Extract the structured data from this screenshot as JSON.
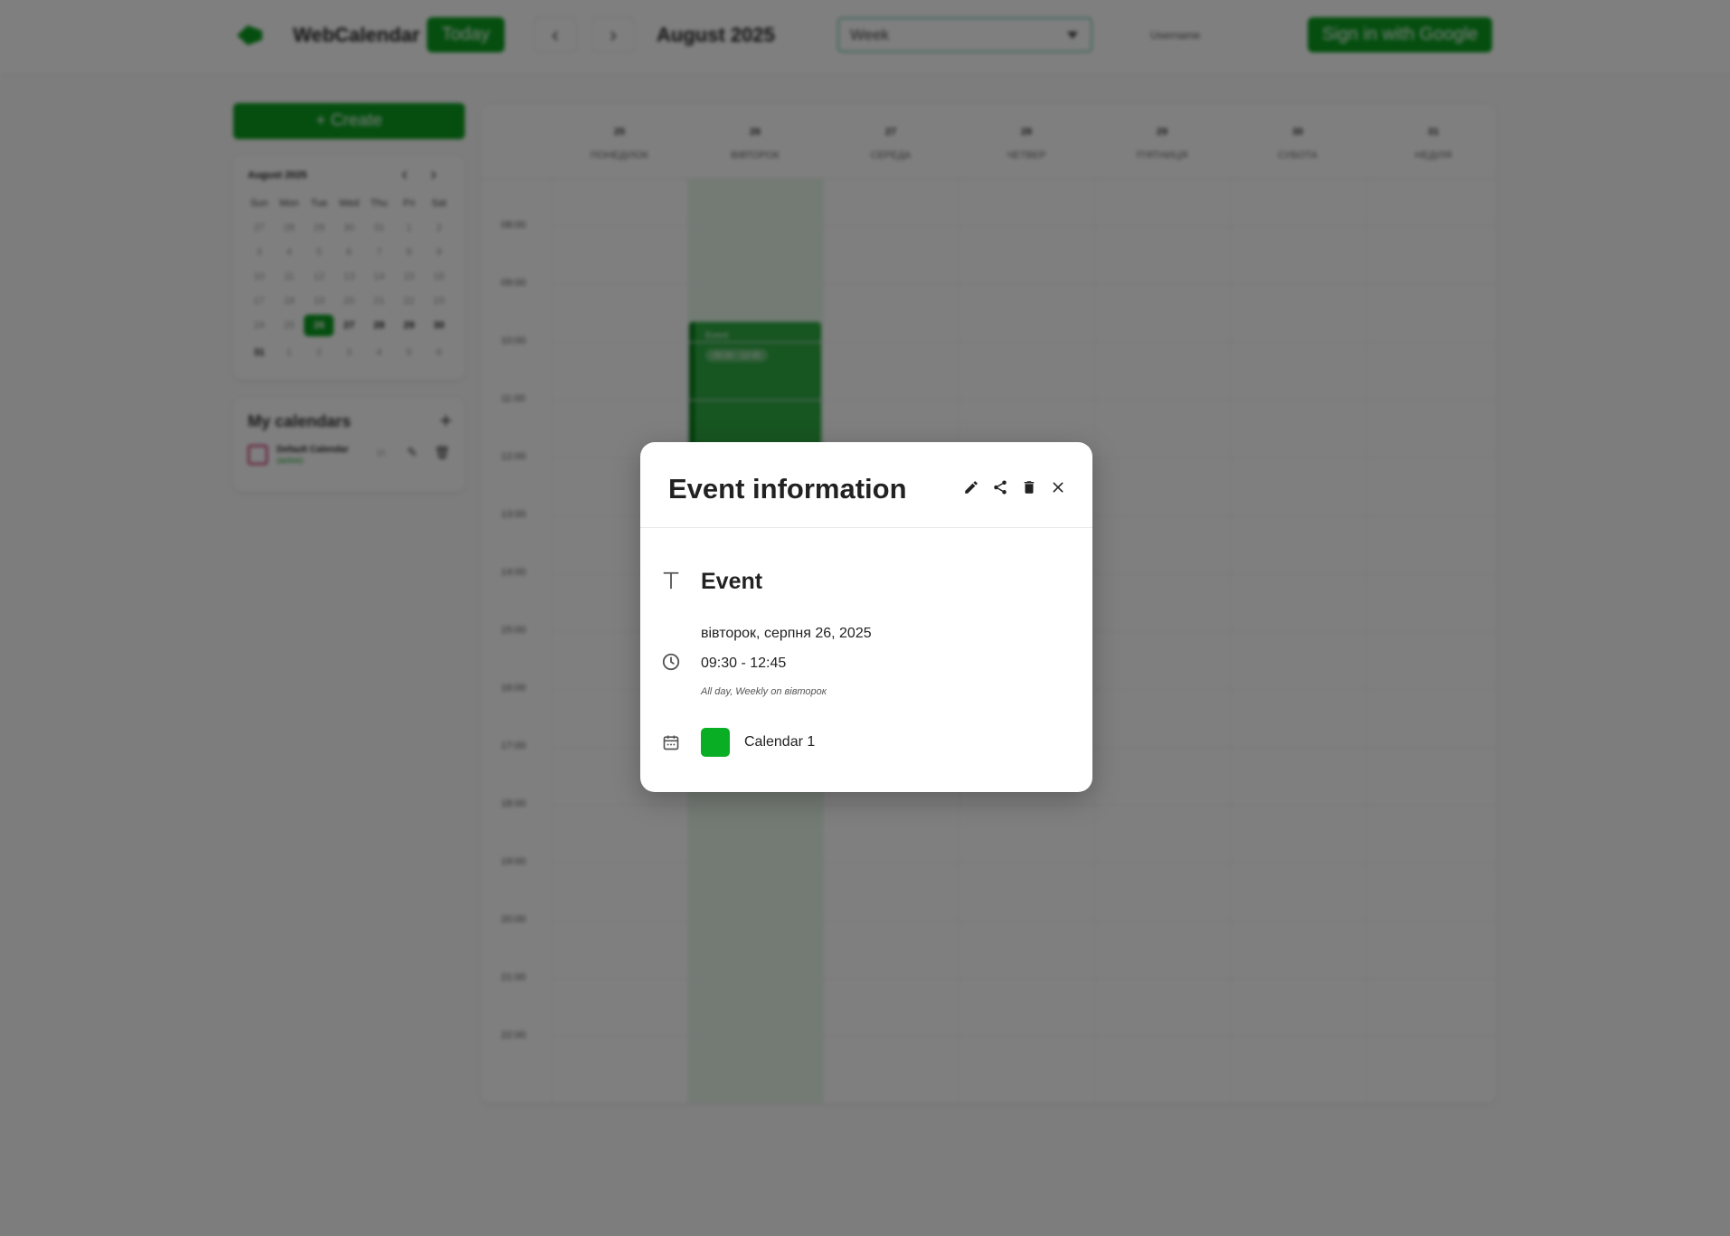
{
  "header": {
    "brand": "WebCalendar",
    "today_label": "Today",
    "prev_arrow": "‹",
    "next_arrow": "›",
    "month_title": "August 2025",
    "view_selected": "Week",
    "username": "Username",
    "signin_label": "Sign in with Google"
  },
  "sidebar": {
    "create_label": "+ Create",
    "mini_calendar": {
      "title": "August 2025",
      "weekdays": [
        "Sun",
        "Mon",
        "Tue",
        "Wed",
        "Thu",
        "Fri",
        "Sat"
      ],
      "weeks": [
        [
          "27",
          "28",
          "29",
          "30",
          "31",
          "1",
          "2"
        ],
        [
          "3",
          "4",
          "5",
          "6",
          "7",
          "8",
          "9"
        ],
        [
          "10",
          "11",
          "12",
          "13",
          "14",
          "15",
          "16"
        ],
        [
          "17",
          "18",
          "19",
          "20",
          "21",
          "22",
          "23"
        ],
        [
          "24",
          "25",
          "26",
          "27",
          "28",
          "29",
          "30"
        ],
        [
          "31",
          "1",
          "2",
          "3",
          "4",
          "5",
          "6"
        ]
      ],
      "selected_day": "26"
    },
    "my_calendars": {
      "title": "My calendars",
      "add_label": "+",
      "items": [
        {
          "name": "Default Calendar",
          "status": "(active)",
          "flag": "15",
          "color": "#c2185b"
        }
      ]
    }
  },
  "week": {
    "days": [
      {
        "num": "25",
        "name": "ПОНЕДІЛОК"
      },
      {
        "num": "26",
        "name": "ВІВТОРОК"
      },
      {
        "num": "27",
        "name": "СЕРЕДА"
      },
      {
        "num": "28",
        "name": "ЧЕТВЕР"
      },
      {
        "num": "29",
        "name": "П'ЯТНИЦЯ"
      },
      {
        "num": "30",
        "name": "СУБОТА"
      },
      {
        "num": "31",
        "name": "НЕДІЛЯ"
      }
    ],
    "hours": [
      "08:00",
      "09:00",
      "10:00",
      "11:00",
      "12:00",
      "13:00",
      "14:00",
      "15:00",
      "16:00",
      "17:00",
      "18:00",
      "19:00",
      "20:00",
      "21:00",
      "22:00"
    ],
    "event_block": {
      "title": "Event",
      "time": "09:30 - 12:45"
    }
  },
  "modal": {
    "title": "Event information",
    "actions": [
      "pencil-icon",
      "share-icon",
      "trash-icon",
      "close-icon"
    ],
    "event_title": "Event",
    "date_text": "вівторок, серпня 26, 2025",
    "time_range": "09:30 - 12:45",
    "recurrence": "All day, Weekly on вівторок",
    "calendar_name": "Calendar 1",
    "calendar_color": "#0aae25"
  },
  "colors": {
    "accent": "#0a9d1f",
    "overlay": "rgba(0,0,0,0.5)"
  }
}
